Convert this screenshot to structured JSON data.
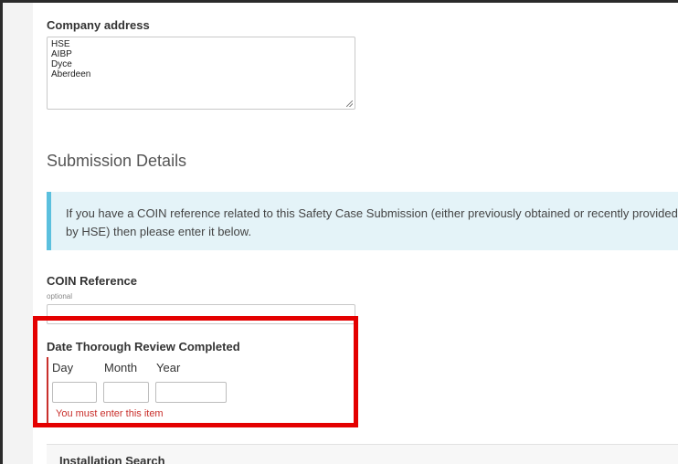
{
  "company_address": {
    "label": "Company address",
    "lines": [
      "HSE",
      "AIBP",
      "Dyce",
      "Aberdeen"
    ]
  },
  "submission_details": {
    "title": "Submission Details",
    "info_text": "If you have a COIN reference related to this Safety Case Submission (either previously obtained or recently provided by HSE) then please enter it below."
  },
  "coin_reference": {
    "label": "COIN Reference",
    "hint": "optional",
    "value": ""
  },
  "date_review": {
    "label": "Date Thorough Review Completed",
    "day_label": "Day",
    "month_label": "Month",
    "year_label": "Year",
    "day_value": "",
    "month_value": "",
    "year_value": "",
    "error": "You must enter this item"
  },
  "installation_search": {
    "title": "Installation Search"
  },
  "colors": {
    "highlight": "#e40000",
    "error": "#c9302c",
    "info_background": "#e4f3f8",
    "info_border": "#5bc0de"
  }
}
